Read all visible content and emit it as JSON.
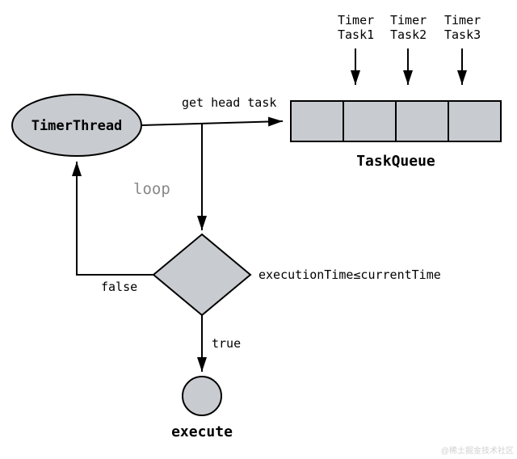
{
  "nodes": {
    "timerThread": "TimerThread",
    "taskQueue": "TaskQueue",
    "execute": "execute"
  },
  "tasks": {
    "t1_line1": "Timer",
    "t1_line2": "Task1",
    "t2_line1": "Timer",
    "t2_line2": "Task2",
    "t3_line1": "Timer",
    "t3_line2": "Task3"
  },
  "edges": {
    "getHeadTask": "get head task",
    "loop": "loop",
    "condition": "executionTime≤currentTime",
    "trueLabel": "true",
    "falseLabel": "false"
  },
  "watermark": "@稀土掘金技术社区",
  "colors": {
    "fill": "#c8ccd0",
    "stroke": "#000000",
    "loopText": "#888888"
  }
}
